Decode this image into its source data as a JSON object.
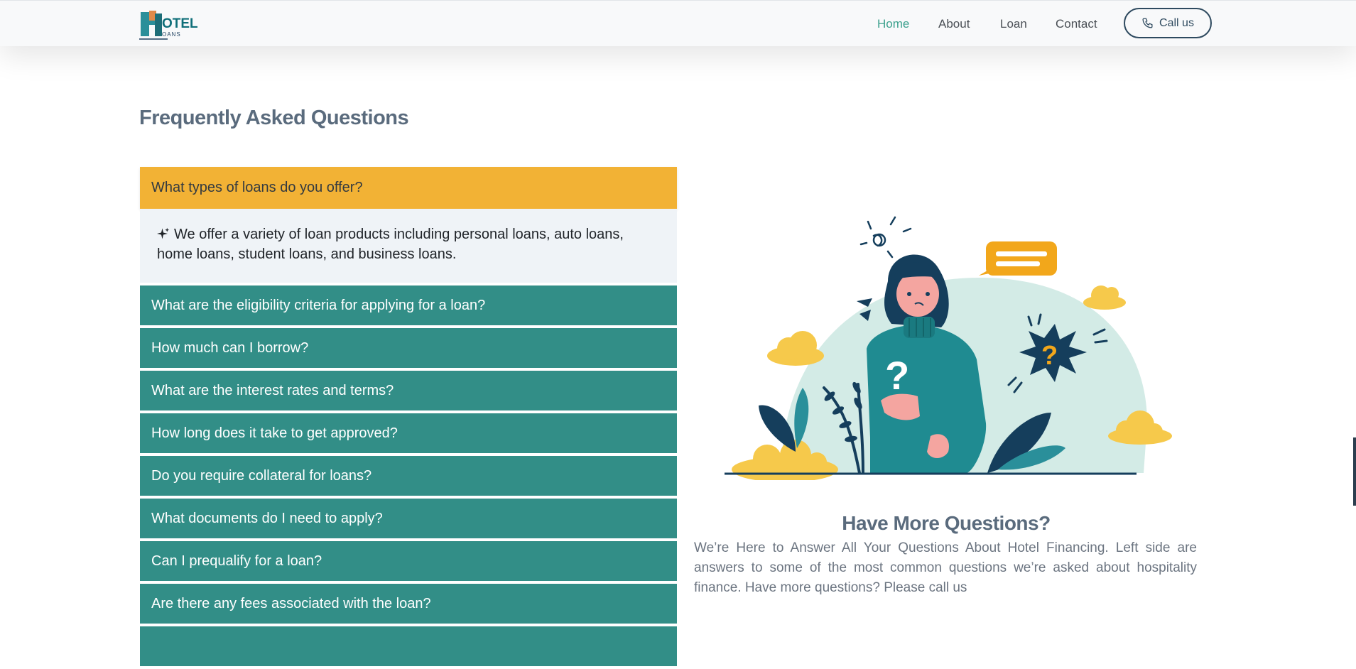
{
  "header": {
    "logo_text": "OTEL",
    "logo_sub": "OANS",
    "nav": [
      {
        "label": "Home",
        "active": true
      },
      {
        "label": "About",
        "active": false
      },
      {
        "label": "Loan",
        "active": false
      },
      {
        "label": "Contact",
        "active": false
      }
    ],
    "call_button": "Call us"
  },
  "faq": {
    "title": "Frequently Asked Questions",
    "open_question": "What types of loans do you offer?",
    "open_answer": "We offer a variety of loan products including personal loans, auto loans, home loans, student loans, and business loans.",
    "questions": [
      "What are the eligibility criteria for applying for a loan?",
      "How much can I borrow?",
      "What are the interest rates and terms?",
      "How long does it take to get approved?",
      "Do you require collateral for loans?",
      "What documents do I need to apply?",
      "Can I prequalify for a loan?",
      "Are there any fees associated with the loan?"
    ]
  },
  "more": {
    "title": "Have More Questions?",
    "text": "We’re Here to Answer All Your Questions About Hotel Financing. Left side are answers to some of the most common questions we’re asked about hospitality finance. Have more questions? Please call us"
  },
  "colors": {
    "accent_teal": "#328e87",
    "open_yellow": "#f2b235",
    "nav_active": "#3aa08c",
    "heading": "#5a6b7d"
  }
}
